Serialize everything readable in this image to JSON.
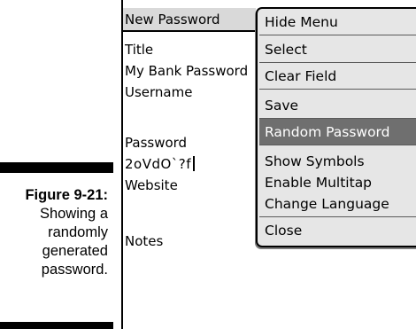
{
  "caption": {
    "figure_label": "Figure 9-21:",
    "lines": [
      "Showing a",
      "randomly",
      "generated",
      "password."
    ]
  },
  "screen": {
    "title": "New Password",
    "fields": {
      "title_label": "Title",
      "title_value": "My Bank Password",
      "username_label": "Username",
      "password_label": "Password",
      "password_value": "2oVdO`?f",
      "website_label": "Website",
      "notes_label": "Notes"
    }
  },
  "menu": {
    "items": [
      {
        "label": "Hide Menu"
      },
      {
        "label": "Select"
      },
      {
        "label": "Clear Field"
      },
      {
        "label": "Save"
      },
      {
        "label": "Random Password",
        "selected": true
      },
      {
        "label": "Show Symbols"
      },
      {
        "label": "Enable Multitap"
      },
      {
        "label": "Change Language"
      },
      {
        "label": "Close"
      }
    ]
  },
  "colors": {
    "selected_bg": "#6f6f6f",
    "menu_bg": "#e6e6e6",
    "titlebar_bg": "#d9d9d9"
  }
}
